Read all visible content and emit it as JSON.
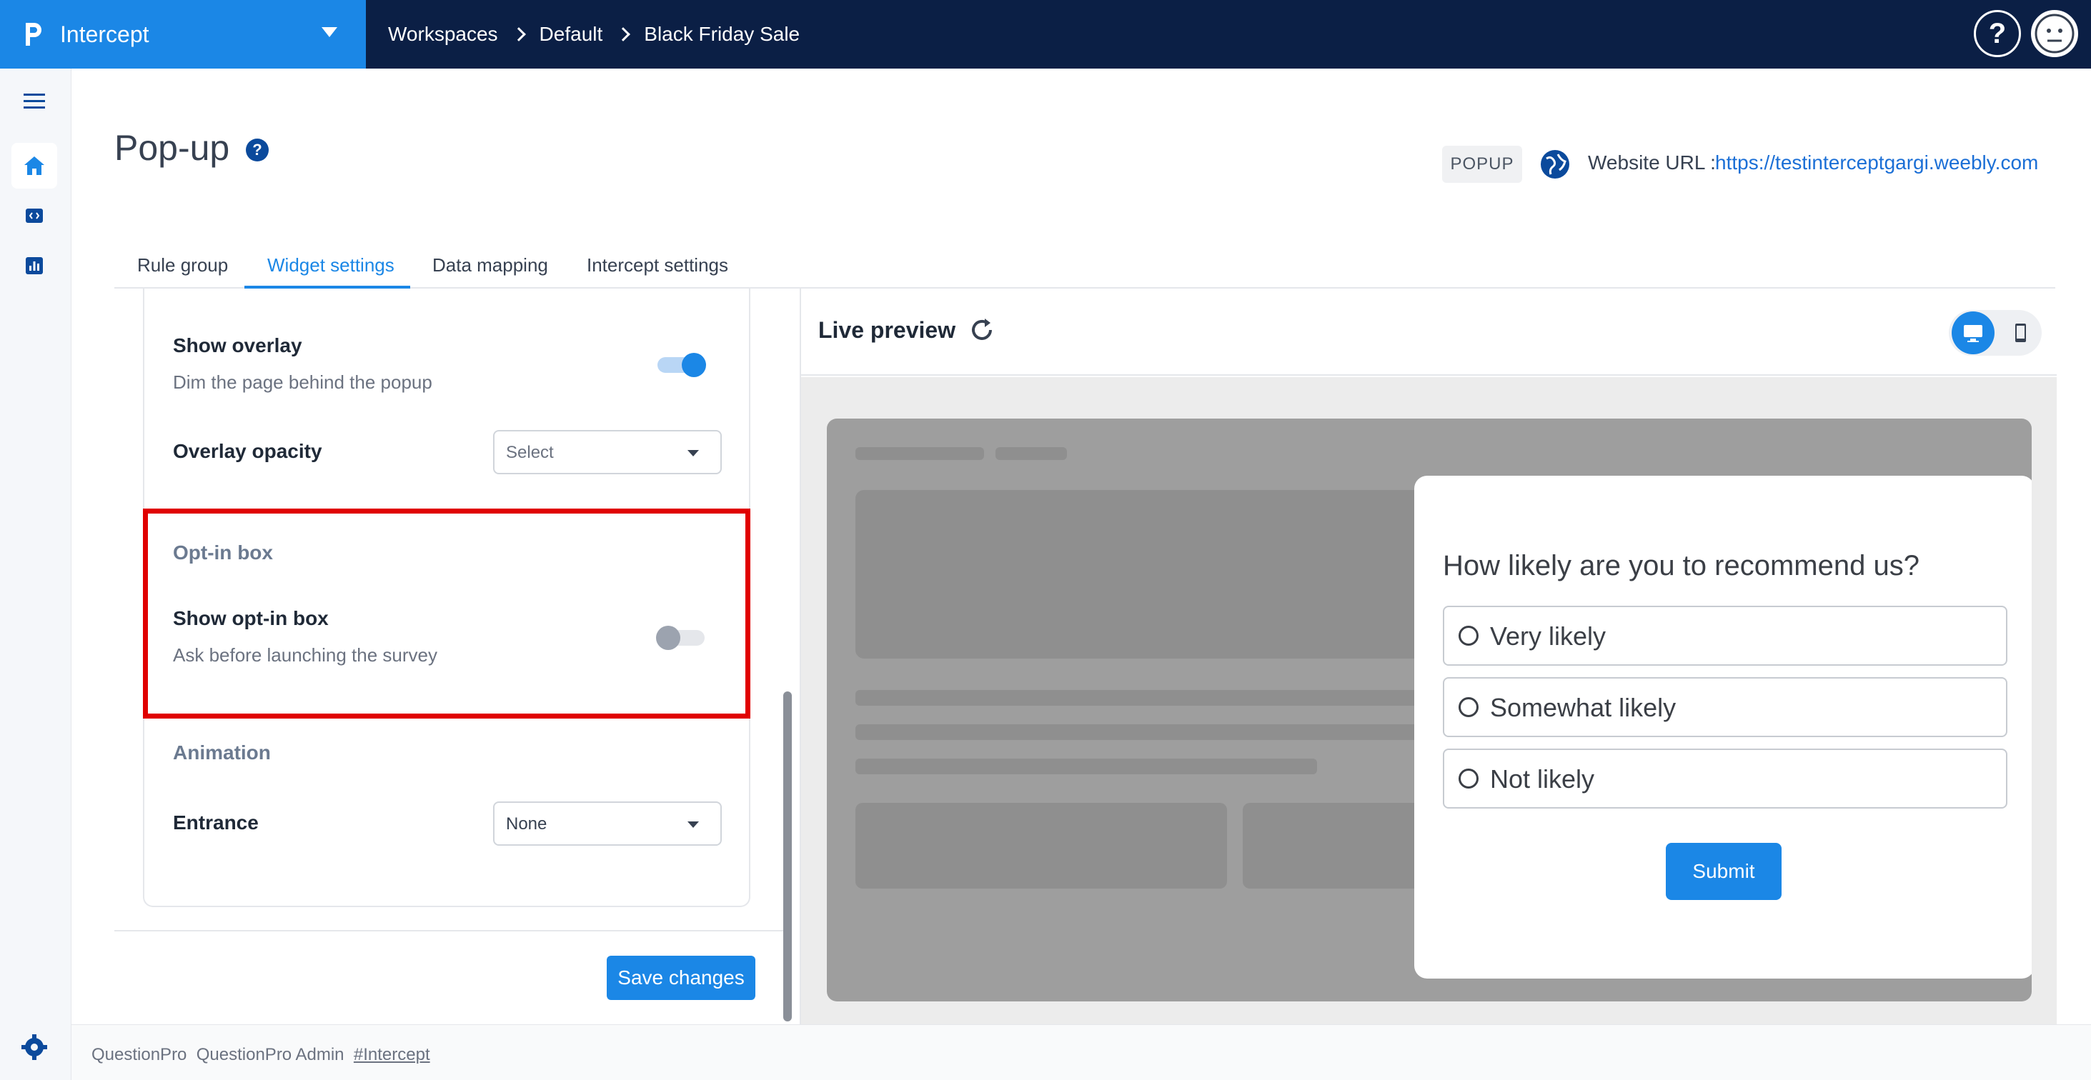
{
  "app": {
    "name": "Intercept"
  },
  "breadcrumb": [
    "Workspaces",
    "Default",
    "Black Friday Sale"
  ],
  "header": {
    "title": "Pop-up",
    "type_badge": "POPUP",
    "url_label": "Website URL :",
    "url": "https://testinterceptgargi.weebly.com"
  },
  "tabs": [
    {
      "label": "Rule group",
      "active": false
    },
    {
      "label": "Widget settings",
      "active": true
    },
    {
      "label": "Data mapping",
      "active": false
    },
    {
      "label": "Intercept settings",
      "active": false
    }
  ],
  "settings": {
    "show_overlay": {
      "title": "Show overlay",
      "sub": "Dim the page behind the popup",
      "enabled": true
    },
    "overlay_opacity": {
      "title": "Overlay opacity",
      "value": "Select"
    },
    "optin_section": "Opt-in box",
    "show_optin": {
      "title": "Show opt-in box",
      "sub": "Ask before launching the survey",
      "enabled": false
    },
    "animation_section": "Animation",
    "entrance": {
      "title": "Entrance",
      "value": "None"
    },
    "save_label": "Save changes"
  },
  "preview": {
    "title": "Live preview",
    "question": "How likely are you to recommend us?",
    "options": [
      "Very likely",
      "Somewhat likely",
      "Not likely"
    ],
    "submit_label": "Submit"
  },
  "footer": {
    "org": "QuestionPro",
    "user": "QuestionPro Admin",
    "tag": "#Intercept"
  },
  "colors": {
    "brand": "#1b87e6",
    "navy": "#0b1f45",
    "highlight": "#e00000"
  },
  "icons": [
    "logo-icon",
    "chevron-down-icon",
    "help-icon",
    "avatar-icon",
    "menu-icon",
    "home-icon",
    "code-icon",
    "chart-icon",
    "gear-icon",
    "globe-icon",
    "refresh-icon",
    "desktop-icon",
    "mobile-icon"
  ]
}
